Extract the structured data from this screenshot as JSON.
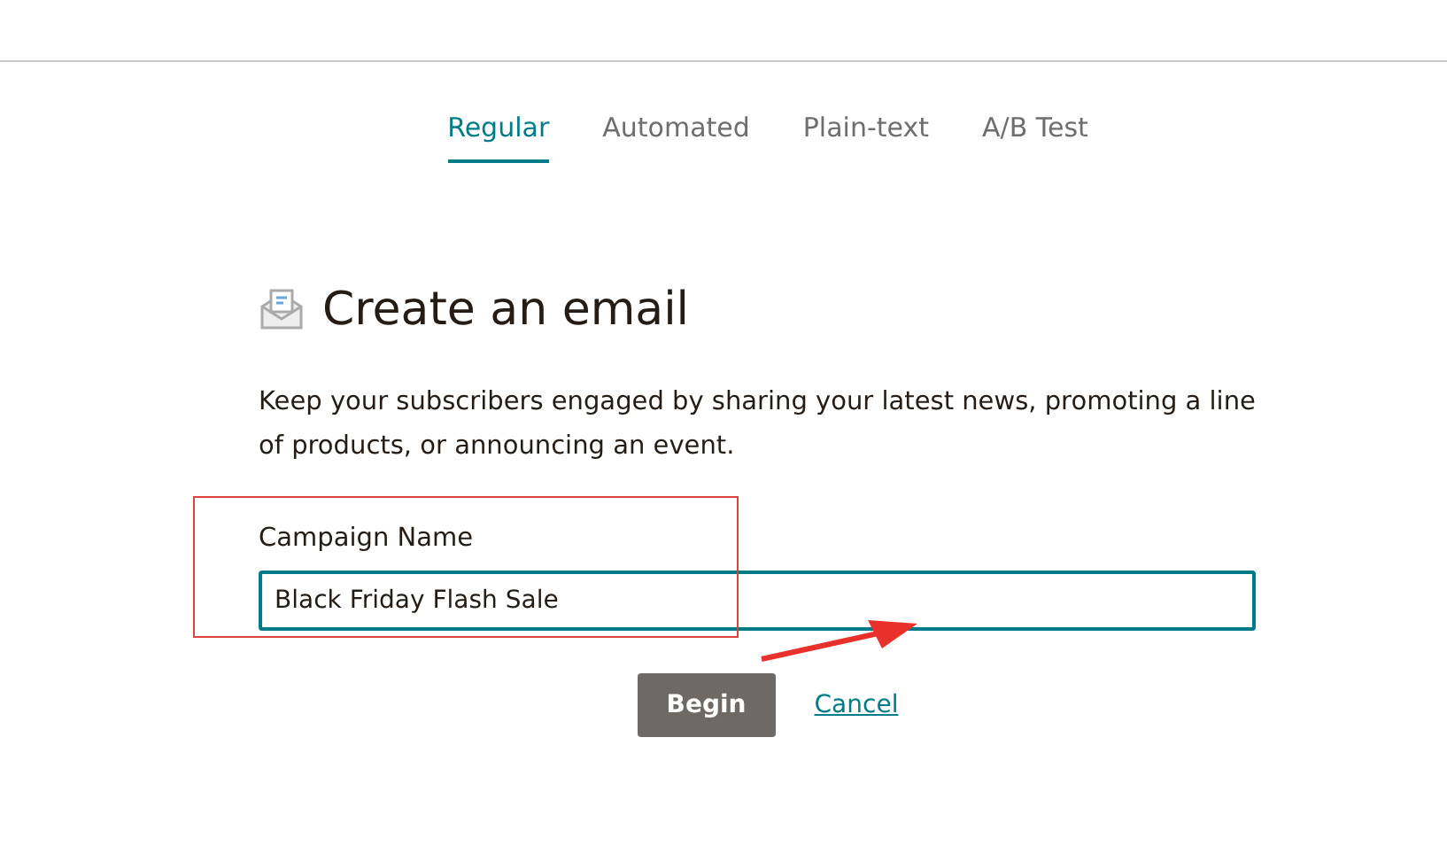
{
  "tabs": [
    {
      "label": "Regular",
      "selected": true
    },
    {
      "label": "Automated",
      "selected": false
    },
    {
      "label": "Plain-text",
      "selected": false
    },
    {
      "label": "A/B Test",
      "selected": false
    }
  ],
  "heading": "Create an email",
  "description": "Keep your subscribers engaged by sharing your latest news, promoting a line of products, or announcing an event.",
  "campaign_name": {
    "label": "Campaign Name",
    "value": "Black Friday Flash Sale"
  },
  "buttons": {
    "primary": "Begin",
    "secondary": "Cancel"
  }
}
